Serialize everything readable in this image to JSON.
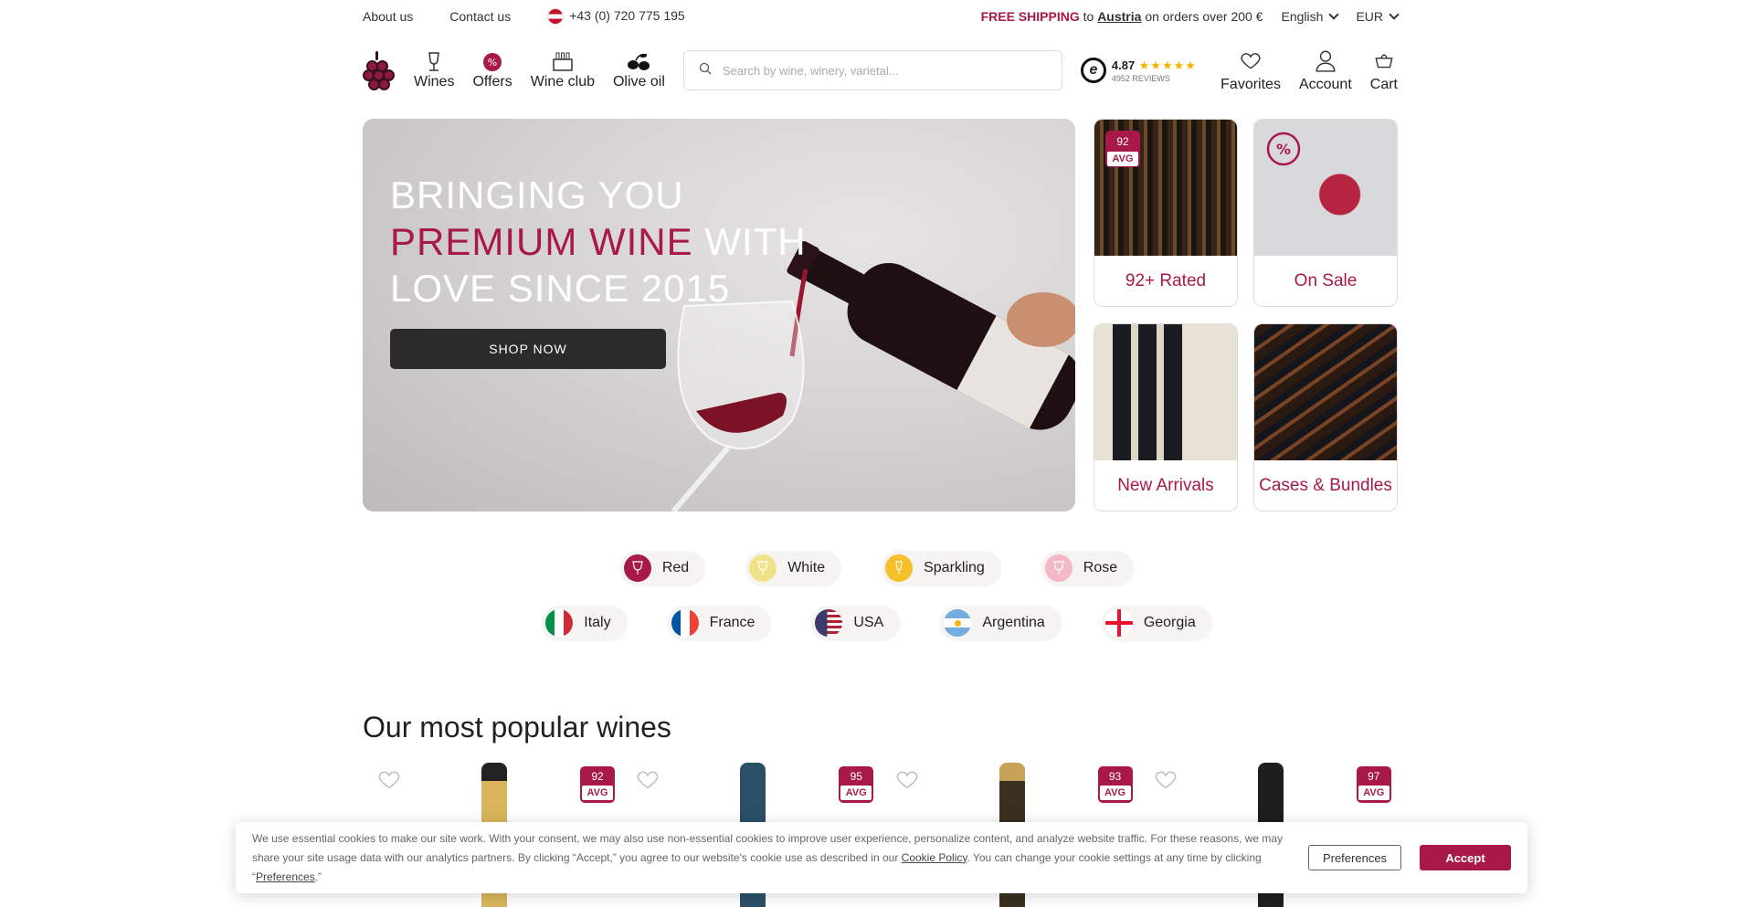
{
  "topbar": {
    "about": "About us",
    "contact": "Contact us",
    "phone": "+43 (0) 720 775 195",
    "shipping_strong": "FREE SHIPPING",
    "shipping_to": "to",
    "shipping_country": "Austria",
    "shipping_rest": "on orders over 200 €",
    "language": "English",
    "currency": "EUR"
  },
  "nav": {
    "items": [
      {
        "label": "Wines",
        "icon": "wine-glass-icon"
      },
      {
        "label": "Offers",
        "icon": "percent-badge-icon"
      },
      {
        "label": "Wine club",
        "icon": "wine-crate-icon"
      },
      {
        "label": "Olive oil",
        "icon": "olives-icon"
      }
    ]
  },
  "search": {
    "placeholder": "Search by wine, winery, varietal..."
  },
  "rating": {
    "score": "4.87",
    "stars": "★★★★★",
    "reviews": "4952 REVIEWS"
  },
  "header_icons": {
    "favorites": "Favorites",
    "account": "Account",
    "cart": "Cart"
  },
  "hero": {
    "line1": "BRINGING YOU",
    "highlight": "PREMIUM WINE",
    "line2_rest": "WITH",
    "line3": "LOVE SINCE 2015",
    "cta": "SHOP NOW"
  },
  "tiles": [
    {
      "label": "92+ Rated",
      "badge_num": "92",
      "badge_txt": "AVG"
    },
    {
      "label": "On Sale"
    },
    {
      "label": "New Arrivals"
    },
    {
      "label": "Cases & Bundles"
    }
  ],
  "wine_types": [
    {
      "label": "Red",
      "color": "#a8194a"
    },
    {
      "label": "White",
      "color": "#f0e28a"
    },
    {
      "label": "Sparkling",
      "color": "#f5c02a"
    },
    {
      "label": "Rose",
      "color": "#f2b8c6"
    }
  ],
  "countries": [
    {
      "label": "Italy"
    },
    {
      "label": "France"
    },
    {
      "label": "USA"
    },
    {
      "label": "Argentina"
    },
    {
      "label": "Georgia"
    }
  ],
  "popular": {
    "title": "Our most popular wines",
    "products": [
      {
        "score": "92",
        "avg": "AVG",
        "bottle_color": "#d8b55a"
      },
      {
        "score": "95",
        "avg": "AVG",
        "bottle_color": "#2a5068"
      },
      {
        "score": "93",
        "avg": "AVG",
        "bottle_color": "#3a3020"
      },
      {
        "score": "97",
        "avg": "AVG",
        "bottle_color": "#1e1e1e"
      }
    ]
  },
  "cookie": {
    "text1": "We use essential cookies to make our site work. With your consent, we may also use non-essential cookies to improve user experience, personalize content, and analyze website traffic. For these reasons, we may share your site usage data with our analytics partners. By clicking “Accept,” you agree to our website's cookie use as described in our",
    "policy_link": "Cookie Policy",
    "text2": ". You can change your cookie settings at any time by clicking “",
    "pref_link": "Preferences",
    "text3": ".”",
    "preferences_btn": "Preferences",
    "accept_btn": "Accept"
  },
  "colors": {
    "brand": "#a8194a",
    "dark": "#2b2b2b"
  }
}
